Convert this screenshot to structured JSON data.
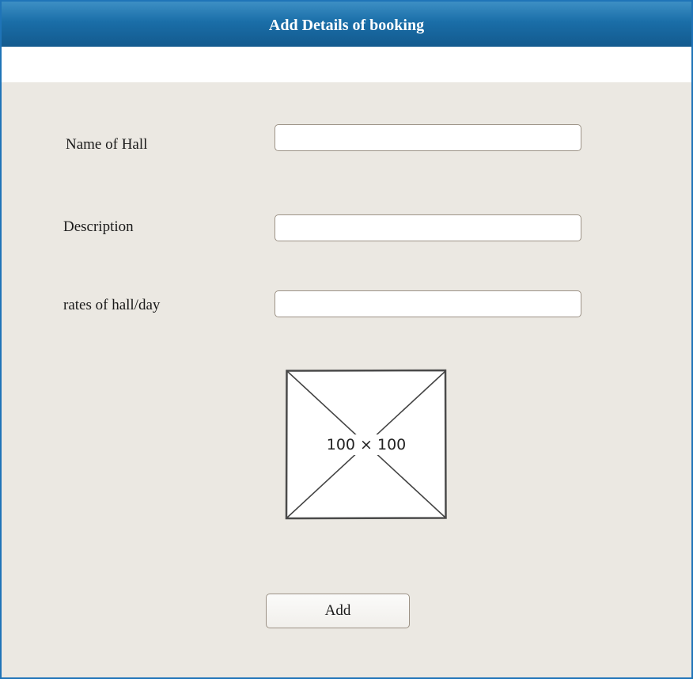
{
  "window": {
    "title": "Add Details of booking"
  },
  "form": {
    "fields": [
      {
        "label": "Name of Hall",
        "value": "",
        "placeholder": ""
      },
      {
        "label": "Description",
        "value": "",
        "placeholder": ""
      },
      {
        "label": "rates of hall/day",
        "value": "",
        "placeholder": ""
      }
    ],
    "image_placeholder": {
      "caption": "100 × 100",
      "icon": "image-placeholder-icon"
    },
    "submit_label": "Add"
  },
  "colors": {
    "titlebar": "#1a6ea8",
    "window_border": "#1f74b8",
    "panel_background": "#ebe8e2",
    "input_border": "#9c9286"
  }
}
